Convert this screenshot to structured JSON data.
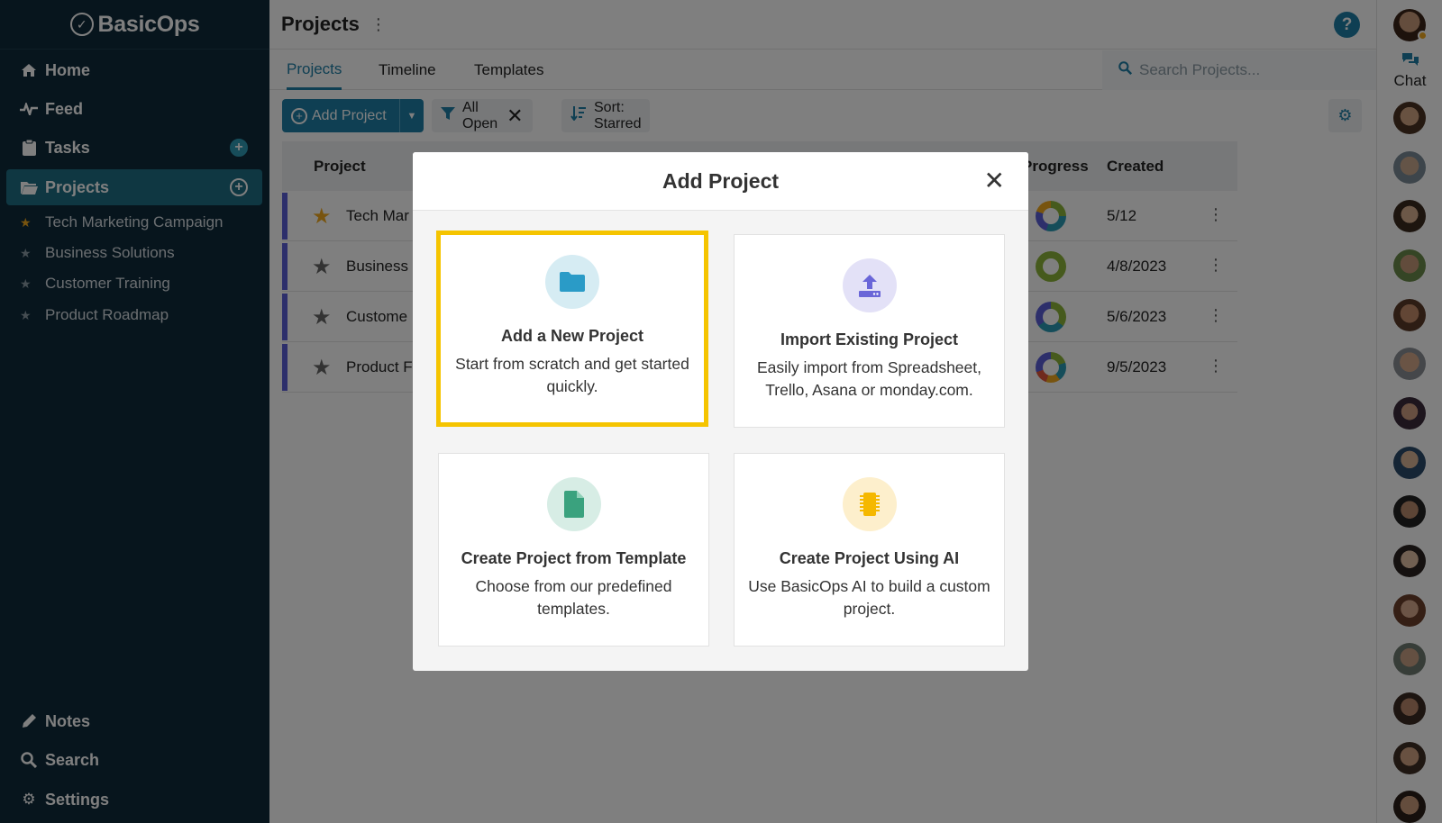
{
  "app": {
    "brand": "BasicOps"
  },
  "sidebar": {
    "nav": [
      {
        "label": "Home",
        "icon": "home-icon"
      },
      {
        "label": "Feed",
        "icon": "pulse-icon"
      },
      {
        "label": "Tasks",
        "icon": "clipboard-icon"
      },
      {
        "label": "Projects",
        "icon": "folder-icon"
      }
    ],
    "projects": [
      {
        "label": "Tech Marketing Campaign",
        "starred": true
      },
      {
        "label": "Business Solutions",
        "starred": false
      },
      {
        "label": "Customer Training",
        "starred": false
      },
      {
        "label": "Product Roadmap",
        "starred": false
      }
    ],
    "bottom": [
      {
        "label": "Notes",
        "icon": "pencil-icon"
      },
      {
        "label": "Search",
        "icon": "search-icon"
      },
      {
        "label": "Settings",
        "icon": "gear-icon"
      }
    ]
  },
  "header": {
    "title": "Projects"
  },
  "tabs": [
    "Projects",
    "Timeline",
    "Templates"
  ],
  "search": {
    "placeholder": "Search Projects..."
  },
  "toolbar": {
    "add_label": "Add Project",
    "filter_label": "All Open",
    "sort_label": "Sort: Starred"
  },
  "table": {
    "headers": {
      "project": "Project",
      "progress": "Progress",
      "created": "Created"
    },
    "rows": [
      {
        "name": "Tech Mar",
        "created": "5/12"
      },
      {
        "name": "Business",
        "created": "4/8/2023"
      },
      {
        "name": "Custome",
        "created": "5/6/2023"
      },
      {
        "name": "Product F",
        "created": "9/5/2023"
      }
    ]
  },
  "rail": {
    "chat_label": "Chat"
  },
  "modal": {
    "title": "Add Project",
    "options": [
      {
        "title": "Add a New Project",
        "desc": "Start from scratch and get started quickly.",
        "icon": "folder-icon"
      },
      {
        "title": "Import Existing Project",
        "desc": "Easily import from Spreadsheet, Trello, Asana or monday.com.",
        "icon": "upload-icon"
      },
      {
        "title": "Create Project from Template",
        "desc": "Choose from our predefined templates.",
        "icon": "document-icon"
      },
      {
        "title": "Create Project Using AI",
        "desc": "Use BasicOps AI to build a custom project.",
        "icon": "chip-icon"
      }
    ]
  },
  "colors": {
    "sidebar_bg": "#0f2b3b",
    "accent": "#1f7fa6",
    "selected_border": "#f5c400"
  }
}
